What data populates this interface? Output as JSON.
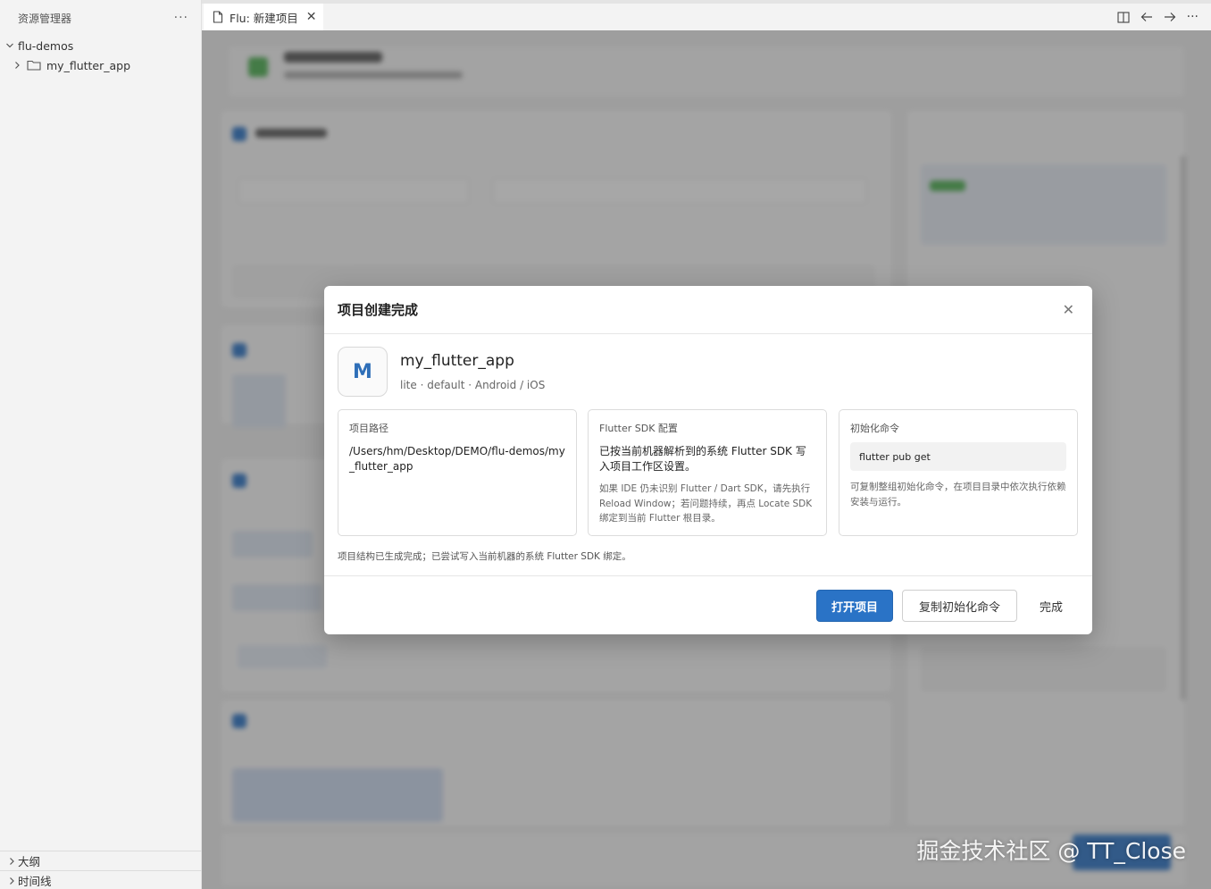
{
  "sidebar": {
    "title": "资源管理器",
    "more": "···",
    "root": "flu-demos",
    "child": "my_flutter_app",
    "outline": "大纲",
    "timeline": "时间线"
  },
  "tabbar": {
    "tab_label": "Flu: 新建项目",
    "close": "✕",
    "more": "···"
  },
  "watermark": "掘金技术社区 @ TT_Close",
  "modal": {
    "title": "项目创建完成",
    "close": "✕",
    "avatar_letter": "M",
    "project_name": "my_flutter_app",
    "project_meta": "lite · default · Android / iOS",
    "cards": {
      "path": {
        "label": "项目路径",
        "value": "/Users/hm/Desktop/DEMO/flu-demos/my_flutter_app"
      },
      "sdk": {
        "label": "Flutter SDK 配置",
        "value": "已按当前机器解析到的系统 Flutter SDK 写入项目工作区设置。",
        "hint": "如果 IDE 仍未识别 Flutter / Dart SDK，请先执行 Reload Window；若问题持续，再点 Locate SDK 绑定到当前 Flutter 根目录。"
      },
      "init": {
        "label": "初始化命令",
        "command": "flutter pub get",
        "hint": "可复制整组初始化命令，在项目目录中依次执行依赖安装与运行。"
      }
    },
    "note": "项目结构已生成完成；已尝试写入当前机器的系统 Flutter SDK 绑定。",
    "buttons": {
      "open": "打开项目",
      "copy": "复制初始化命令",
      "done": "完成"
    }
  }
}
